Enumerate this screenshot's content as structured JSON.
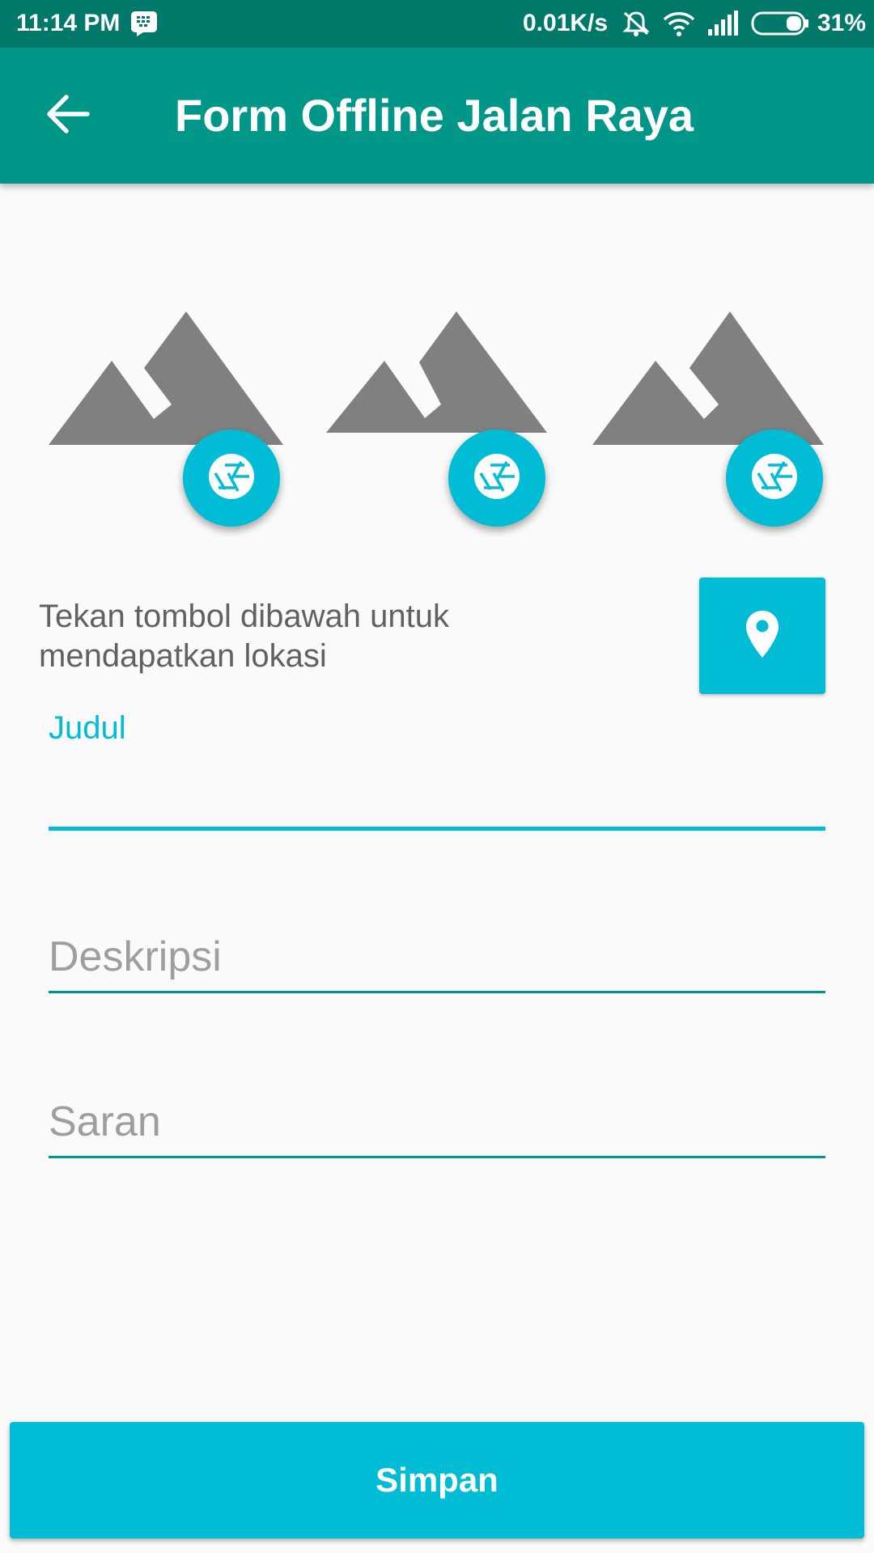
{
  "status_bar": {
    "time": "11:14 PM",
    "net_speed": "0.01K/s",
    "battery": "31%",
    "icons": [
      "bbm-notification-icon",
      "vibrate-off-icon",
      "wifi-icon",
      "signal-icon",
      "battery-icon"
    ]
  },
  "app_bar": {
    "title": "Form Offline Jalan Raya",
    "back_icon": "arrow-back-icon"
  },
  "photos": {
    "placeholder_icon": "landscape-image-icon",
    "camera_icon": "camera-shutter-icon",
    "count": 3
  },
  "location": {
    "instruction": "Tekan tombol dibawah untuk mendapatkan lokasi",
    "button_icon": "location-pin-icon"
  },
  "form": {
    "judul": {
      "label": "Judul",
      "value": ""
    },
    "deskripsi": {
      "placeholder": "Deskripsi",
      "value": ""
    },
    "saran": {
      "placeholder": "Saran",
      "value": ""
    }
  },
  "save_button": {
    "label": "Simpan"
  },
  "colors": {
    "status_bar": "#00796b",
    "app_bar": "#009688",
    "accent": "#00bcd4",
    "placeholder_image": "#808080",
    "background": "#fafafa"
  }
}
